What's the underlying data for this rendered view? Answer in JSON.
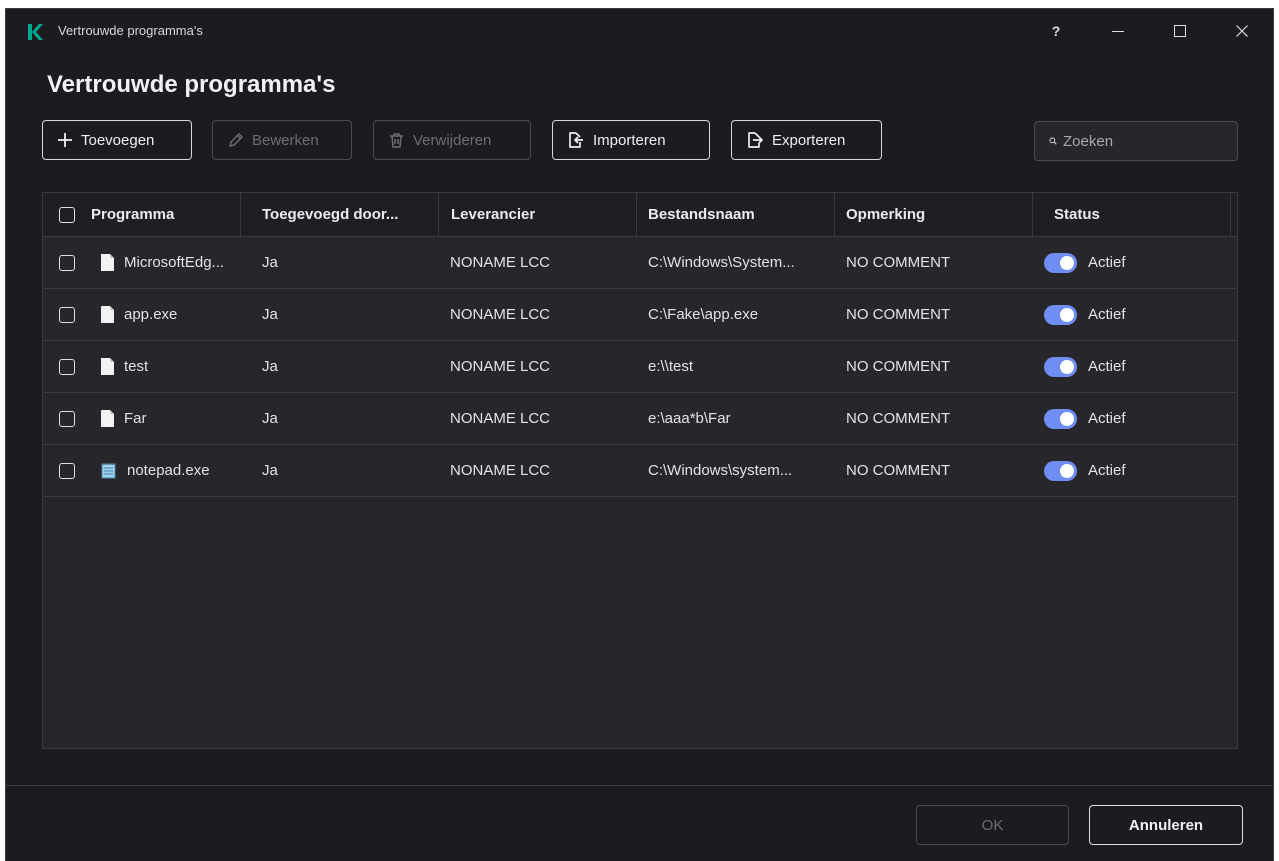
{
  "window": {
    "title": "Vertrouwde programma's",
    "help_label": "?"
  },
  "page": {
    "title": "Vertrouwde programma's"
  },
  "toolbar": {
    "add_label": "Toevoegen",
    "edit_label": "Bewerken",
    "delete_label": "Verwijderen",
    "import_label": "Importeren",
    "export_label": "Exporteren",
    "edit_enabled": false,
    "delete_enabled": false
  },
  "search": {
    "placeholder": "Zoeken",
    "value": ""
  },
  "table": {
    "columns": [
      "Programma",
      "Toegevoegd door...",
      "Leverancier",
      "Bestandsnaam",
      "Opmerking",
      "Status"
    ],
    "rows": [
      {
        "program": "MicrosoftEdg...",
        "icon": "file-icon",
        "added_by": "Ja",
        "vendor": "NONAME LCC",
        "filename": "C:\\Windows\\System...",
        "comment": "NO COMMENT",
        "status": "Actief",
        "enabled": true
      },
      {
        "program": "app.exe",
        "icon": "file-icon",
        "added_by": "Ja",
        "vendor": "NONAME LCC",
        "filename": "C:\\Fake\\app.exe",
        "comment": "NO COMMENT",
        "status": "Actief",
        "enabled": true
      },
      {
        "program": "test",
        "icon": "file-icon",
        "added_by": "Ja",
        "vendor": "NONAME LCC",
        "filename": "e:\\\\test",
        "comment": "NO COMMENT",
        "status": "Actief",
        "enabled": true
      },
      {
        "program": "Far",
        "icon": "file-icon",
        "added_by": "Ja",
        "vendor": "NONAME LCC",
        "filename": "e:\\aaa*b\\Far",
        "comment": "NO COMMENT",
        "status": "Actief",
        "enabled": true
      },
      {
        "program": "notepad.exe",
        "icon": "notepad-icon",
        "added_by": "Ja",
        "vendor": "NONAME LCC",
        "filename": "C:\\Windows\\system...",
        "comment": "NO COMMENT",
        "status": "Actief",
        "enabled": true
      }
    ]
  },
  "footer": {
    "ok_label": "OK",
    "cancel_label": "Annuleren",
    "ok_enabled": false
  },
  "colors": {
    "background": "#1c1c20",
    "table_background": "#26262b",
    "accent_toggle": "#6f8df2",
    "logo": "#00a88e"
  }
}
